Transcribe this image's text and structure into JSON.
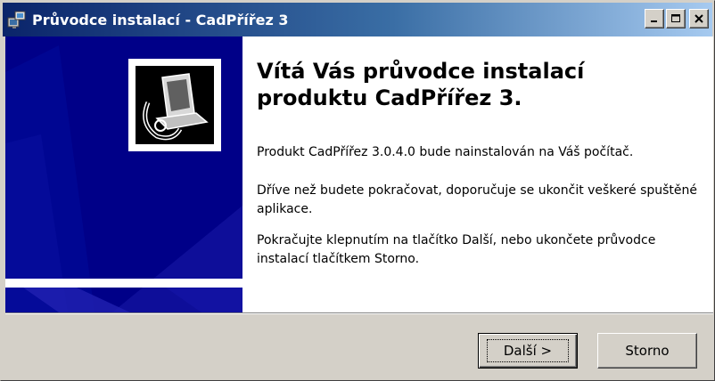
{
  "window": {
    "title": "Průvodce instalací - CadPřířez 3",
    "app_icon": "installer-icon",
    "controls": {
      "minimize": "minimize-icon",
      "maximize": "maximize-icon",
      "close": "close-icon"
    }
  },
  "banner": {
    "icon": "setup-computer-icon"
  },
  "content": {
    "heading": "Vítá Vás průvodce instalací produktu CadPřířez 3.",
    "paragraph1": "Produkt CadPřířez 3.0.4.0 bude nainstalován na Váš počítač.",
    "paragraph2": "Dříve než budete pokračovat, doporučuje se ukončit veškeré spuštěné aplikace.",
    "paragraph3": "Pokračujte klepnutím na tlačítko Další, nebo ukončete průvodce instalací tlačítkem Storno."
  },
  "buttons": {
    "next_label": "Další >",
    "cancel_label": "Storno"
  },
  "colors": {
    "title_bar": "#0a246a",
    "banner_background": "#000088",
    "face": "#d4d0c8"
  }
}
